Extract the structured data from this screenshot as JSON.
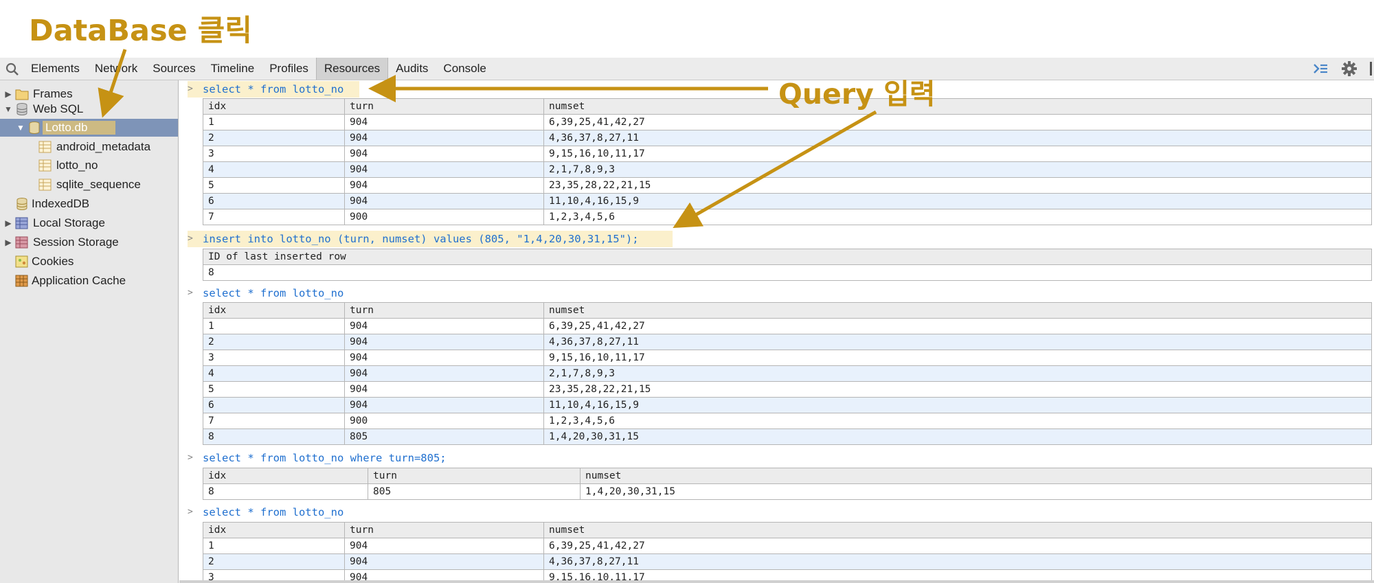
{
  "annotations": {
    "database_click": "DataBase 클릭",
    "query_input": "Query 입력",
    "color": "#c69214"
  },
  "toolbar": {
    "tabs": [
      {
        "label": "Elements"
      },
      {
        "label": "Network"
      },
      {
        "label": "Sources"
      },
      {
        "label": "Timeline"
      },
      {
        "label": "Profiles"
      },
      {
        "label": "Resources",
        "active": true
      },
      {
        "label": "Audits"
      },
      {
        "label": "Console"
      }
    ]
  },
  "sidebar": {
    "items": [
      {
        "label": "Frames",
        "icon": "folder-icon"
      },
      {
        "label": "Web SQL",
        "icon": "database-icon"
      },
      {
        "label": "Lotto.db",
        "icon": "database-icon",
        "selected": true
      },
      {
        "label": "android_metadata",
        "icon": "table-icon"
      },
      {
        "label": "lotto_no",
        "icon": "table-icon"
      },
      {
        "label": "sqlite_sequence",
        "icon": "table-icon"
      },
      {
        "label": "IndexedDB",
        "icon": "database-icon"
      },
      {
        "label": "Local Storage",
        "icon": "storage-grid-icon"
      },
      {
        "label": "Session Storage",
        "icon": "storage-grid-icon"
      },
      {
        "label": "Cookies",
        "icon": "cookie-icon"
      },
      {
        "label": "Application Cache",
        "icon": "app-cache-icon"
      }
    ]
  },
  "console": {
    "blocks": [
      {
        "command": "select * from lotto_no",
        "columns": [
          "idx",
          "turn",
          "numset"
        ],
        "rows": [
          [
            "1",
            "904",
            "6,39,25,41,42,27"
          ],
          [
            "2",
            "904",
            "4,36,37,8,27,11"
          ],
          [
            "3",
            "904",
            "9,15,16,10,11,17"
          ],
          [
            "4",
            "904",
            "2,1,7,8,9,3"
          ],
          [
            "5",
            "904",
            "23,35,28,22,21,15"
          ],
          [
            "6",
            "904",
            "11,10,4,16,15,9"
          ],
          [
            "7",
            "900",
            "1,2,3,4,5,6"
          ]
        ]
      },
      {
        "command": "insert into lotto_no (turn, numset) values (805, \"1,4,20,30,31,15\");",
        "columns": [
          "ID of last inserted row"
        ],
        "rows": [
          [
            "8"
          ]
        ]
      },
      {
        "command": "select * from lotto_no",
        "columns": [
          "idx",
          "turn",
          "numset"
        ],
        "rows": [
          [
            "1",
            "904",
            "6,39,25,41,42,27"
          ],
          [
            "2",
            "904",
            "4,36,37,8,27,11"
          ],
          [
            "3",
            "904",
            "9,15,16,10,11,17"
          ],
          [
            "4",
            "904",
            "2,1,7,8,9,3"
          ],
          [
            "5",
            "904",
            "23,35,28,22,21,15"
          ],
          [
            "6",
            "904",
            "11,10,4,16,15,9"
          ],
          [
            "7",
            "900",
            "1,2,3,4,5,6"
          ],
          [
            "8",
            "805",
            "1,4,20,30,31,15"
          ]
        ]
      },
      {
        "command": "select * from lotto_no where turn=805;",
        "columns": [
          "idx",
          "turn",
          "numset"
        ],
        "rows": [
          [
            "8",
            "805",
            "1,4,20,30,31,15"
          ]
        ]
      },
      {
        "command": "select * from lotto_no",
        "columns": [
          "idx",
          "turn",
          "numset"
        ],
        "rows": [
          [
            "1",
            "904",
            "6,39,25,41,42,27"
          ],
          [
            "2",
            "904",
            "4,36,37,8,27,11"
          ],
          [
            "3",
            "904",
            "9,15,16,10,11,17"
          ]
        ]
      }
    ]
  }
}
